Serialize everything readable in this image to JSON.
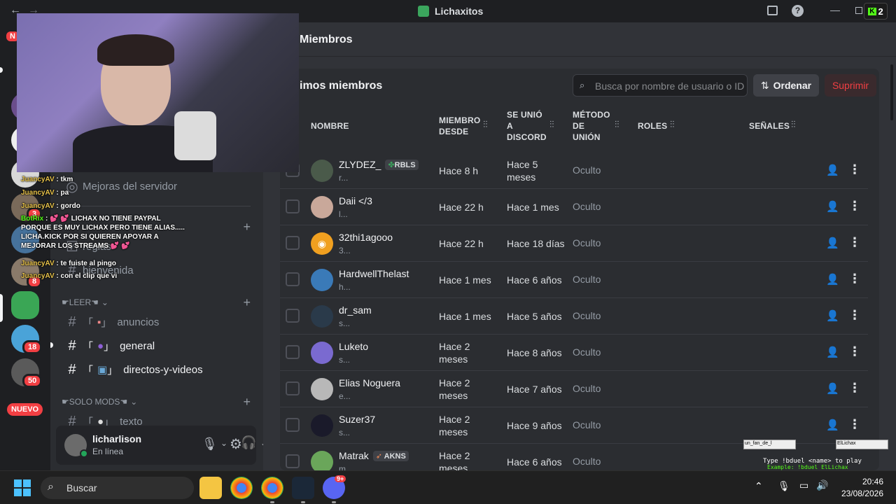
{
  "titlebar": {
    "server_name": "Lichaxitos",
    "kick_count": "2"
  },
  "header": {
    "title": "Miembros"
  },
  "toolbar": {
    "section_title": "imos miembros",
    "search_placeholder": "Busca por nombre de usuario o ID",
    "sort_label": "Ordenar",
    "delete_label": "Suprimir"
  },
  "table": {
    "columns": [
      "NOMBRE",
      "MIEMBRO\nDESDE",
      "SE UNIÓ\nA\nDISCORD",
      "MÉTODO\nDE\nUNIÓN",
      "ROLES",
      "SEÑALES"
    ],
    "rows": [
      {
        "name": "ZLYDEZ_",
        "tag": "RBLS",
        "sub": "r...",
        "member_since": "Hace 8 h",
        "joined": "Hace 5 meses",
        "method": "Oculto"
      },
      {
        "name": "Daii </3",
        "tag": "",
        "sub": "l...",
        "member_since": "Hace 22 h",
        "joined": "Hace 1 mes",
        "method": "Oculto"
      },
      {
        "name": "32thi1agooo",
        "tag": "",
        "sub": "3...",
        "member_since": "Hace 22 h",
        "joined": "Hace 18 días",
        "method": "Oculto"
      },
      {
        "name": "HardwellThelast",
        "tag": "",
        "sub": "h...",
        "member_since": "Hace 1 mes",
        "joined": "Hace 6 años",
        "method": "Oculto"
      },
      {
        "name": "dr_sam",
        "tag": "",
        "sub": "s...",
        "member_since": "Hace 1 mes",
        "joined": "Hace 5 años",
        "method": "Oculto"
      },
      {
        "name": "Luketo",
        "tag": "",
        "sub": "s...",
        "member_since": "Hace 2 meses",
        "joined": "Hace 8 años",
        "method": "Oculto"
      },
      {
        "name": "Elias Noguera",
        "tag": "",
        "sub": "e...",
        "member_since": "Hace 2 meses",
        "joined": "Hace 7 años",
        "method": "Oculto"
      },
      {
        "name": "Suzer37",
        "tag": "",
        "sub": "s...",
        "member_since": "Hace 2 meses",
        "joined": "Hace 9 años",
        "method": "Oculto"
      },
      {
        "name": "Matrak",
        "tag": "AKNS",
        "sub": "m...",
        "member_since": "Hace 2 meses",
        "joined": "Hace 6 años",
        "method": "Oculto"
      }
    ]
  },
  "sidebar": {
    "boost": "Mejoras del servidor",
    "ch_reglas": "reglas",
    "ch_bienvenida": "bienvenida",
    "cat_leer": "☛LEER☚",
    "ch_anuncios": "anuncios",
    "ch_general": "general",
    "ch_directos": "directos-y-videos",
    "cat_mods": "☛SOLO MODS☚",
    "ch_texto": "texto",
    "bracket_l": "「",
    "bracket_r": "」"
  },
  "servers": {
    "badge_18": "18",
    "badge_50": "50",
    "badge_3": "3",
    "badge_8": "8",
    "nuevo": "NUEVO",
    "top_badge": "N"
  },
  "user": {
    "name": "licharlison",
    "status": "En línea"
  },
  "chat": [
    {
      "user": "JuancyAV",
      "text": ": tkm"
    },
    {
      "user": "JuancyAV",
      "text": ": pa"
    },
    {
      "user": "JuancyAV",
      "text": ": gordo"
    },
    {
      "user": "BotRix",
      "text": ": 💕 💕 LICHAX NO TIENE PAYPAL PORQUE ES MUY LICHAX PERO TIENE ALIAS..... LICHA.KICK POR SI QUIEREN APOYAR A MEJORAR LOS STREAMS 💕 💕"
    },
    {
      "user": "JuancyAV",
      "text": ": te fuiste al pingo"
    },
    {
      "user": "JuancyAV",
      "text": ": con el clip que vi"
    }
  ],
  "overlay": {
    "duel_a": "un_fan_de_l",
    "duel_b": "ElLichax",
    "duel_cmd": "Type !bduel <name> to play",
    "duel_ex": "Example: !bduel ElLichax"
  },
  "taskbar": {
    "search": "Buscar",
    "time": "20:46",
    "date": "23/08/2026",
    "discord_badge": "9+"
  }
}
